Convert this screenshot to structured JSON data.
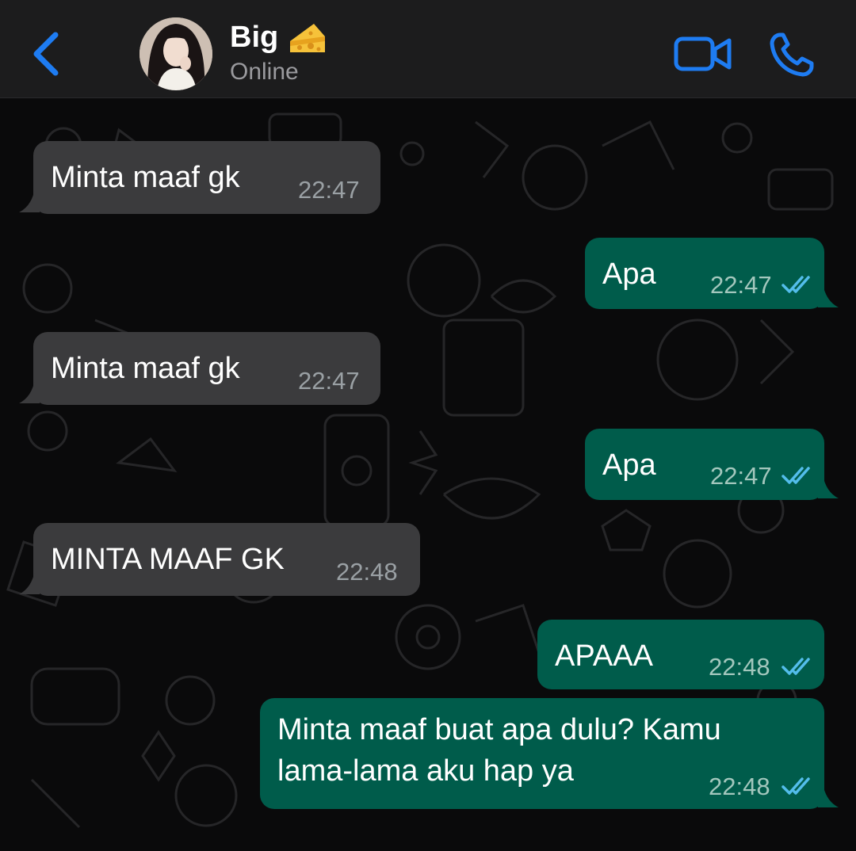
{
  "header": {
    "contact_name": "Big",
    "status": "Online",
    "icons": [
      "back-chevron-icon",
      "cheese-emoji-icon",
      "video-call-icon",
      "phone-call-icon"
    ],
    "accent_color": "#1e7cf2"
  },
  "messages": [
    {
      "direction": "in",
      "text": "Minta maaf gk",
      "time": "22:47"
    },
    {
      "direction": "out",
      "text": "Apa",
      "time": "22:47",
      "read": true
    },
    {
      "direction": "in",
      "text": "Minta maaf gk",
      "time": "22:47"
    },
    {
      "direction": "out",
      "text": "Apa",
      "time": "22:47",
      "read": true
    },
    {
      "direction": "in",
      "text": "MINTA MAAF GK",
      "time": "22:48"
    },
    {
      "direction": "out",
      "text": "APAAA",
      "time": "22:48",
      "read": true
    },
    {
      "direction": "out",
      "text_line1": "Minta maaf buat apa dulu? Kamu",
      "text_line2": "lama-lama aku hap ya",
      "time": "22:48",
      "read": true
    }
  ],
  "colors": {
    "incoming_bubble": "#3b3b3d",
    "outgoing_bubble": "#005c4b",
    "read_ticks": "#53bdeb"
  }
}
